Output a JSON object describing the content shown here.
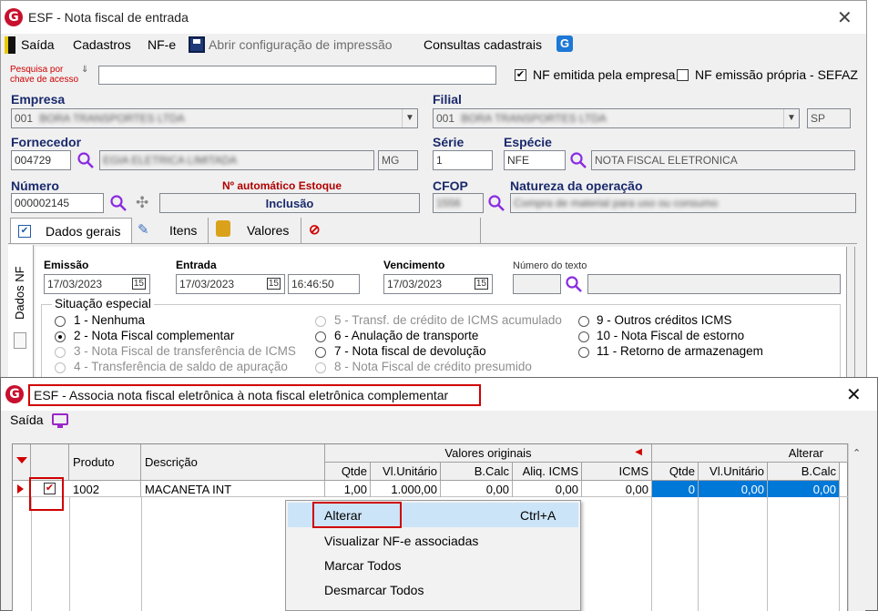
{
  "main_window": {
    "title": "ESF - Nota fiscal de entrada",
    "menu": {
      "saida": "Saída",
      "cadastros": "Cadastros",
      "nfe": "NF-e",
      "abrir_config": "Abrir configuração de impressão",
      "consultas": "Consultas cadastrais"
    },
    "pesquisa_label_1": "Pesquisa por",
    "pesquisa_label_2": "chave de acesso",
    "pesquisa_value": "",
    "nf_emitida_label": "NF emitida pela empresa",
    "nf_emitida_checked": "✔",
    "nf_propria_label": "NF emissão própria - SEFAZ",
    "empresa": {
      "label": "Empresa",
      "code": "001",
      "name": "BORA TRANSPORTES LTDA"
    },
    "filial": {
      "label": "Filial",
      "code": "001",
      "name": "BORA TRANSPORTES LTDA",
      "uf": "SP"
    },
    "fornecedor": {
      "label": "Fornecedor",
      "code": "004729",
      "name": "EGIA ELETRICA LIMITADA",
      "uf": "MG"
    },
    "serie": {
      "label": "Série",
      "value": "1"
    },
    "especie": {
      "label": "Espécie",
      "code": "NFE",
      "desc": "NOTA FISCAL ELETRONICA"
    },
    "numero": {
      "label": "Número",
      "value": "000002145",
      "auto_label": "Nº automático Estoque",
      "mode": "Inclusão"
    },
    "cfop": {
      "label": "CFOP",
      "value": "1556"
    },
    "natureza": {
      "label": "Natureza da operação",
      "value": "Compra de material para uso ou consumo"
    },
    "tabs": {
      "dados_gerais": "Dados gerais",
      "itens": "Itens",
      "valores": "Valores"
    },
    "side_tab": "Dados NF",
    "emissao": {
      "label": "Emissão",
      "value": "17/03/2023"
    },
    "entrada": {
      "label": "Entrada",
      "value": "17/03/2023",
      "time": "16:46:50"
    },
    "vencimento": {
      "label": "Vencimento",
      "value": "17/03/2023"
    },
    "numero_texto_label": "Número do texto",
    "situacao": {
      "label": "Situação especial",
      "options": [
        "1 - Nenhuma",
        "2 - Nota Fiscal complementar",
        "3 - Nota Fiscal de transferência de ICMS",
        "4 - Transferência de saldo de apuração",
        "5 - Transf. de crédito de ICMS acumulado",
        "6 - Anulação de transporte",
        "7 - Nota fiscal de devolução",
        "8 - Nota Fiscal de crédito presumido",
        "9 - Outros créditos ICMS",
        "10 - Nota Fiscal de estorno",
        "11 - Retorno de armazenagem"
      ]
    }
  },
  "dialog": {
    "title": "ESF - Associa nota fiscal eletrônica à nota fiscal eletrônica complementar",
    "saida": "Saída",
    "grid": {
      "group_original": "Valores originais",
      "group_alterar": "Alterar",
      "headers": {
        "produto": "Produto",
        "descricao": "Descrição",
        "qtde": "Qtde",
        "vl_unitario": "Vl.Unitário",
        "bcalc": "B.Calc",
        "aliq_icms": "Aliq. ICMS",
        "icms": "ICMS",
        "alt_qtde": "Qtde",
        "alt_vl_unitario": "Vl.Unitário",
        "alt_bcalc": "B.Calc"
      },
      "row": {
        "checked": "✔",
        "produto": "1002",
        "descricao": "MACANETA INT",
        "qtde": "1,00",
        "vl_unitario": "1.000,00",
        "bcalc": "0,00",
        "aliq_icms": "0,00",
        "icms": "0,00",
        "alt_qtde": "0",
        "alt_vl_unitario": "0,00",
        "alt_bcalc": "0,00"
      }
    }
  },
  "context_menu": {
    "items": [
      {
        "label": "Alterar",
        "shortcut": "Ctrl+A"
      },
      {
        "label": "Visualizar NF-e associadas"
      },
      {
        "label": "Marcar Todos"
      },
      {
        "label": "Desmarcar Todos"
      }
    ]
  }
}
